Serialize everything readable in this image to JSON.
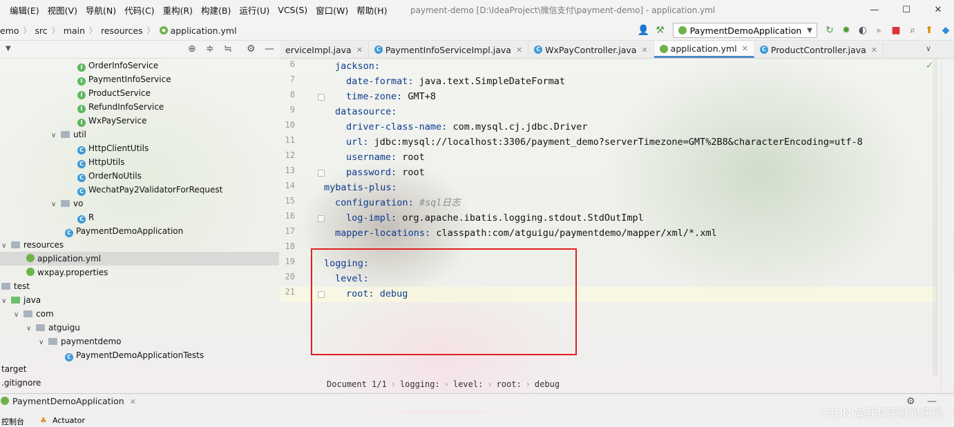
{
  "menu": [
    "编辑(E)",
    "视图(V)",
    "导航(N)",
    "代码(C)",
    "重构(R)",
    "构建(B)",
    "运行(U)",
    "VCS(S)",
    "窗口(W)",
    "帮助(H)"
  ],
  "window_title": "payment-demo [D:\\IdeaProject\\微信支付\\payment-demo] - application.yml",
  "breadcrumbs": [
    "emo",
    "src",
    "main",
    "resources",
    "application.yml"
  ],
  "run_config": "PaymentDemoApplication",
  "tabs": [
    {
      "label": "erviceImpl.java",
      "active": false
    },
    {
      "label": "PaymentInfoServiceImpl.java",
      "active": false
    },
    {
      "label": "WxPayController.java",
      "active": false
    },
    {
      "label": "application.yml",
      "active": true
    },
    {
      "label": "ProductController.java",
      "active": false
    }
  ],
  "tree": [
    {
      "label": "OrderInfoService",
      "icon": "interface-icon"
    },
    {
      "label": "PaymentInfoService",
      "icon": "interface-icon"
    },
    {
      "label": "ProductService",
      "icon": "interface-icon"
    },
    {
      "label": "RefundInfoService",
      "icon": "interface-icon"
    },
    {
      "label": "WxPayService",
      "icon": "interface-icon"
    },
    {
      "label": "util",
      "icon": "folder-icon"
    },
    {
      "label": "HttpClientUtils",
      "icon": "class-icon"
    },
    {
      "label": "HttpUtils",
      "icon": "class-icon"
    },
    {
      "label": "OrderNoUtils",
      "icon": "class-icon"
    },
    {
      "label": "WechatPay2ValidatorForRequest",
      "icon": "class-icon"
    },
    {
      "label": "vo",
      "icon": "folder-icon"
    },
    {
      "label": "R",
      "icon": "class-icon"
    },
    {
      "label": "PaymentDemoApplication",
      "icon": "spring-app-icon"
    },
    {
      "label": "resources",
      "icon": "folder-icon"
    },
    {
      "label": "application.yml",
      "icon": "yml-icon"
    },
    {
      "label": "wxpay.properties",
      "icon": "yml-icon"
    },
    {
      "label": "test",
      "icon": "folder-icon"
    },
    {
      "label": "java",
      "icon": "folder-icon"
    },
    {
      "label": "com",
      "icon": "folder-icon"
    },
    {
      "label": "atguigu",
      "icon": "folder-icon"
    },
    {
      "label": "paymentdemo",
      "icon": "folder-icon"
    },
    {
      "label": "PaymentDemoApplicationTests",
      "icon": "spring-app-icon"
    },
    {
      "label": "target",
      "icon": "none"
    },
    {
      "label": ".gitignore",
      "icon": "none"
    }
  ],
  "code": [
    {
      "n": "6",
      "key": "jackson",
      "val": ""
    },
    {
      "n": "7",
      "key": "date-format",
      "val": "java.text.SimpleDateFormat"
    },
    {
      "n": "8",
      "key": "time-zone",
      "val": "GMT+8"
    },
    {
      "n": "9",
      "key": "datasource",
      "val": ""
    },
    {
      "n": "10",
      "key": "driver-class-name",
      "val": "com.mysql.cj.jdbc.Driver"
    },
    {
      "n": "11",
      "key": "url",
      "val": "jdbc:mysql://localhost:3306/payment_demo?serverTimezone=GMT%2B8&characterEncoding=utf-8"
    },
    {
      "n": "12",
      "key": "username",
      "val": "root"
    },
    {
      "n": "13",
      "key": "password",
      "val": "root"
    },
    {
      "n": "14",
      "key": "mybatis-plus",
      "val": ""
    },
    {
      "n": "15",
      "key": "configuration",
      "val": "",
      "comment": "#sql日志"
    },
    {
      "n": "16",
      "key": "log-impl",
      "val": "org.apache.ibatis.logging.stdout.StdOutImpl"
    },
    {
      "n": "17",
      "key": "mapper-locations",
      "val": "classpath:com/atguigu/paymentdemo/mapper/xml/*.xml"
    },
    {
      "n": "18",
      "key": "",
      "val": ""
    },
    {
      "n": "19",
      "key": "logging",
      "val": ""
    },
    {
      "n": "20",
      "key": "level",
      "val": ""
    },
    {
      "n": "21",
      "key": "root",
      "val": "debug"
    }
  ],
  "editor_breadcrumb": [
    "Document 1/1",
    "logging:",
    "level:",
    "root:",
    "debug"
  ],
  "run_panel": {
    "tab": "PaymentDemoApplication",
    "bottom_left": "控制台",
    "bottom_actuator": "Actuator"
  },
  "watermark": "CSDN @我其实就是演员",
  "colors": {
    "yaml_key": "#0b3a8f",
    "highlight_box": "#e02020",
    "active_tab_underline": "#4a88c7"
  }
}
